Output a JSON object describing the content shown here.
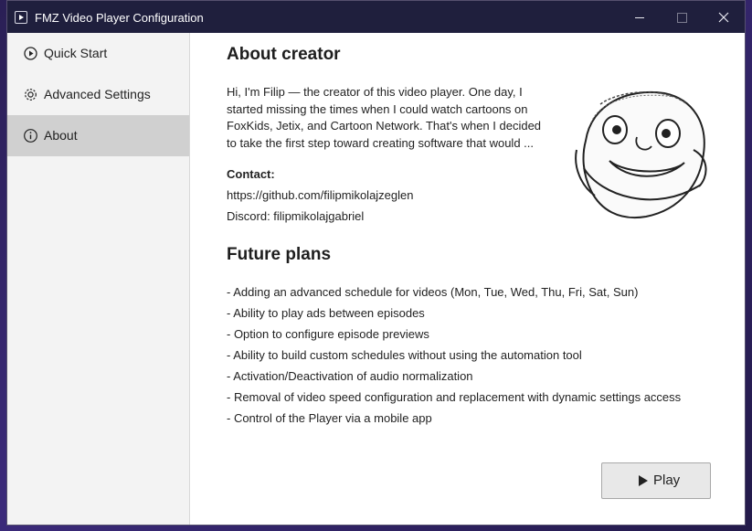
{
  "window": {
    "title": "FMZ Video Player Configuration"
  },
  "sidebar": {
    "items": [
      {
        "label": "Quick Start",
        "icon": "play-circle-icon",
        "active": false
      },
      {
        "label": "Advanced Settings",
        "icon": "gear-icon",
        "active": false
      },
      {
        "label": "About",
        "icon": "info-icon",
        "active": true
      }
    ]
  },
  "about": {
    "heading": "About creator",
    "lines": [
      "Hi, I'm Filip — the creator of this video player. One day, I",
      "started missing the times when I could watch cartoons on",
      "FoxKids, Jetix, and Cartoon Network. That's when I decided",
      "to take the first step toward creating software that would ..."
    ],
    "contact_label": "Contact:",
    "github": "https://github.com/filipmikolajzeglen",
    "discord": "Discord: filipmikolajgabriel"
  },
  "future": {
    "heading": "Future plans",
    "items": [
      "- Adding an advanced schedule for videos (Mon, Tue, Wed, Thu, Fri, Sat, Sun)",
      "- Ability to play ads between episodes",
      "- Option to configure episode previews",
      "- Ability to build custom schedules without using the automation tool",
      "- Activation/Deactivation of audio normalization",
      "- Removal of video speed configuration and replacement with dynamic settings access",
      "- Control of the Player via a mobile app"
    ]
  },
  "play_button": {
    "label": "Play"
  },
  "colors": {
    "titlebar": "#1f1f3d",
    "sidebar": "#f3f3f3",
    "active_item": "#d0d0d0"
  }
}
